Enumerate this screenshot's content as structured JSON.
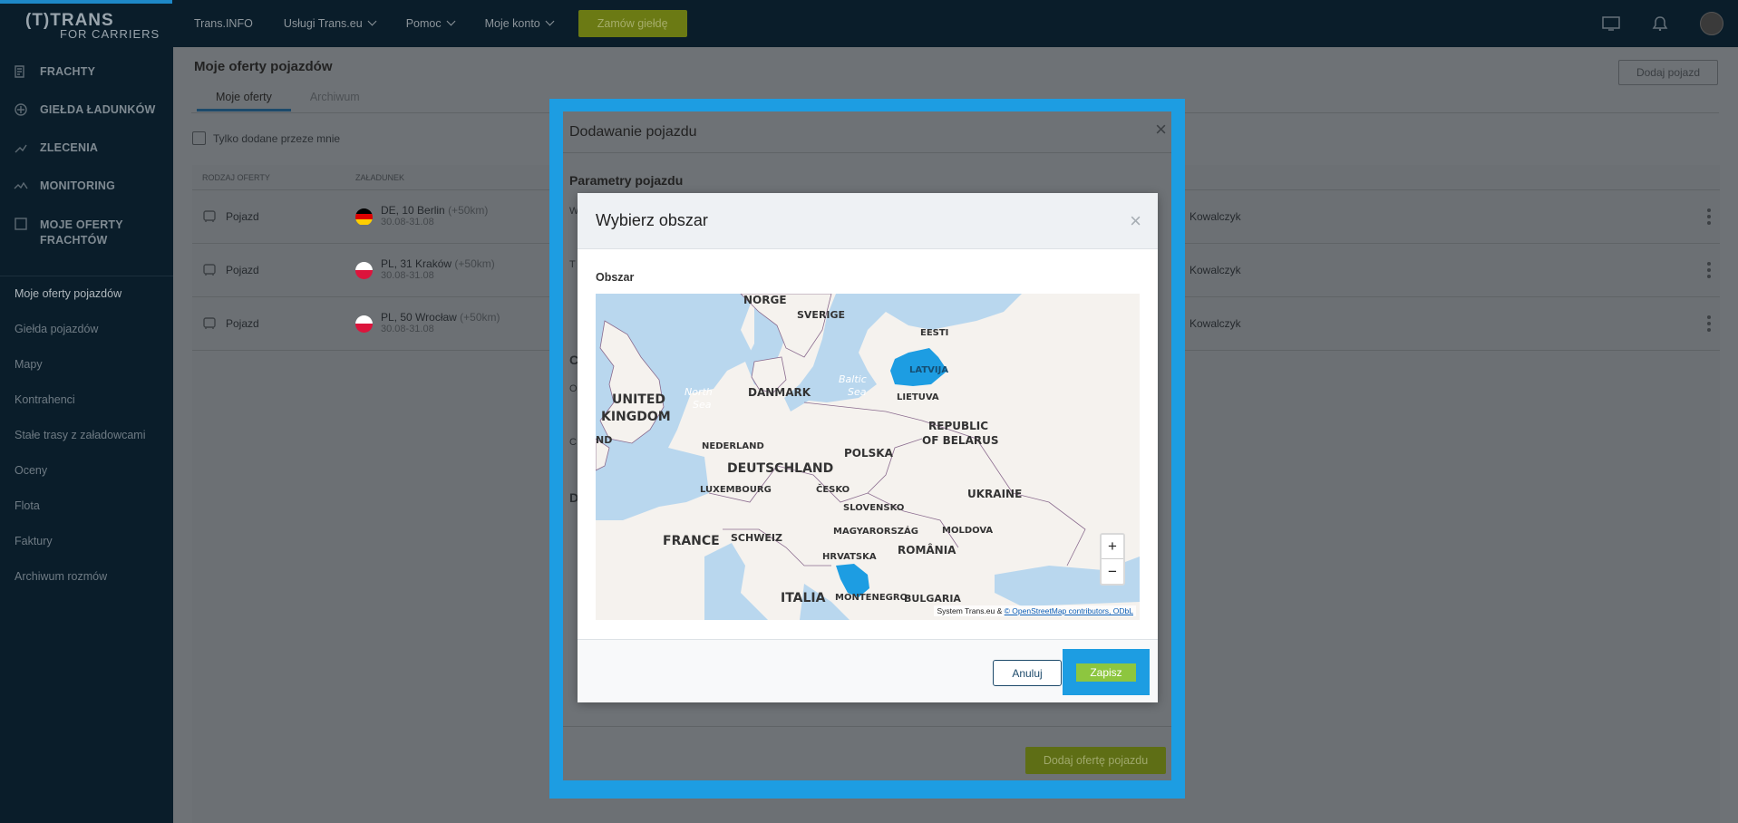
{
  "app": {
    "logo_line1": "(T)TRANS",
    "logo_line2": "FOR CARRIERS"
  },
  "topnav": {
    "items": [
      {
        "label": "Trans.INFO"
      },
      {
        "label": "Usługi Trans.eu"
      },
      {
        "label": "Pomoc"
      },
      {
        "label": "Moje konto"
      }
    ],
    "order_button": "Zamów giełdę"
  },
  "sidebar": {
    "main_items": [
      {
        "label": "FRACHTY",
        "icon": "freight-icon"
      },
      {
        "label": "GIEŁDA ŁADUNKÓW",
        "icon": "cargo-exchange-icon"
      },
      {
        "label": "ZLECENIA",
        "icon": "orders-icon"
      },
      {
        "label": "MONITORING",
        "icon": "monitoring-icon"
      },
      {
        "label": "MOJE OFERTY",
        "label2": "FRACHTÓW",
        "icon": "my-offers-icon"
      }
    ],
    "sub_items": [
      {
        "label": "Moje oferty pojazdów"
      },
      {
        "label": "Giełda pojazdów"
      },
      {
        "label": "Mapy"
      },
      {
        "label": "Kontrahenci"
      },
      {
        "label": "Stałe trasy z załadowcami"
      },
      {
        "label": "Oceny"
      },
      {
        "label": "Flota"
      },
      {
        "label": "Faktury"
      },
      {
        "label": "Archiwum rozmów"
      }
    ]
  },
  "page": {
    "title": "Moje oferty pojazdów",
    "tabs": [
      {
        "label": "Moje oferty"
      },
      {
        "label": "Archiwum"
      }
    ],
    "add_vehicle_button": "Dodaj pojazd",
    "filter_label": "Tylko dodane przeze mnie",
    "table": {
      "headers": [
        "RODZAJ OFERTY",
        "ZAŁADUNEK"
      ],
      "rows": [
        {
          "type": "Pojazd",
          "country": "DE",
          "city": "10 Berlin",
          "km": "(+50km)",
          "dates": "30.08-31.08",
          "person": "Kowalczyk",
          "flag": [
            "#000000",
            "#dd0000",
            "#ffce00"
          ]
        },
        {
          "type": "Pojazd",
          "country": "PL",
          "city": "31 Kraków",
          "km": "(+50km)",
          "dates": "30.08-31.08",
          "person": "Kowalczyk",
          "flag": [
            "#ffffff",
            "#dc143c"
          ]
        },
        {
          "type": "Pojazd",
          "country": "PL",
          "city": "50 Wrocław",
          "km": "(+50km)",
          "dates": "30.08-31.08",
          "person": "Kowalczyk",
          "flag": [
            "#ffffff",
            "#dc143c"
          ]
        }
      ]
    }
  },
  "vehicle_modal": {
    "title": "Dodawanie pojazdu",
    "section_title": "Parametry pojazdu",
    "fragments": [
      "W",
      "T",
      "C",
      "O",
      "C",
      "D"
    ],
    "submit_button": "Dodaj ofertę pojazdu"
  },
  "area_modal": {
    "title": "Wybierz obszar",
    "field_label": "Obszar",
    "map": {
      "labels": [
        {
          "text": "NORGE"
        },
        {
          "text": "SVERIGE"
        },
        {
          "text": "EESTI"
        },
        {
          "text": "LATVIJA"
        },
        {
          "text": "LIETUVA"
        },
        {
          "text": "UNITED"
        },
        {
          "text": "KINGDOM"
        },
        {
          "text": "North"
        },
        {
          "text": "Sea"
        },
        {
          "text": "Baltic"
        },
        {
          "text": "Sea"
        },
        {
          "text": "DANMARK"
        },
        {
          "text": "ND"
        },
        {
          "text": "NEDERLAND"
        },
        {
          "text": "POLSKA"
        },
        {
          "text": "REPUBLIC"
        },
        {
          "text": "OF BELARUS"
        },
        {
          "text": "DEUTSCHLAND"
        },
        {
          "text": "LUXEMBOURG"
        },
        {
          "text": "ČESKO"
        },
        {
          "text": "UKRAINE"
        },
        {
          "text": "SLOVENSKO"
        },
        {
          "text": "FRANCE"
        },
        {
          "text": "SCHWEIZ"
        },
        {
          "text": "MAGYARORSZÁG"
        },
        {
          "text": "MOLDOVA"
        },
        {
          "text": "ROMÂNIA"
        },
        {
          "text": "HRVATSKA"
        },
        {
          "text": "ITALIA"
        },
        {
          "text": "MONTENEGRO"
        },
        {
          "text": "BULGARIA"
        }
      ],
      "selected_region_color": "#1d9de2",
      "zoom_in": "+",
      "zoom_out": "−",
      "attribution_prefix": "System Trans.eu & ",
      "attribution_link": "© OpenStreetMap contributors, ODbL"
    },
    "cancel_button": "Anuluj",
    "save_button": "Zapisz"
  },
  "colors": {
    "accent_blue": "#1d9de2",
    "save_green": "#8dc63f",
    "dark_navy": "#0a1d2a"
  }
}
